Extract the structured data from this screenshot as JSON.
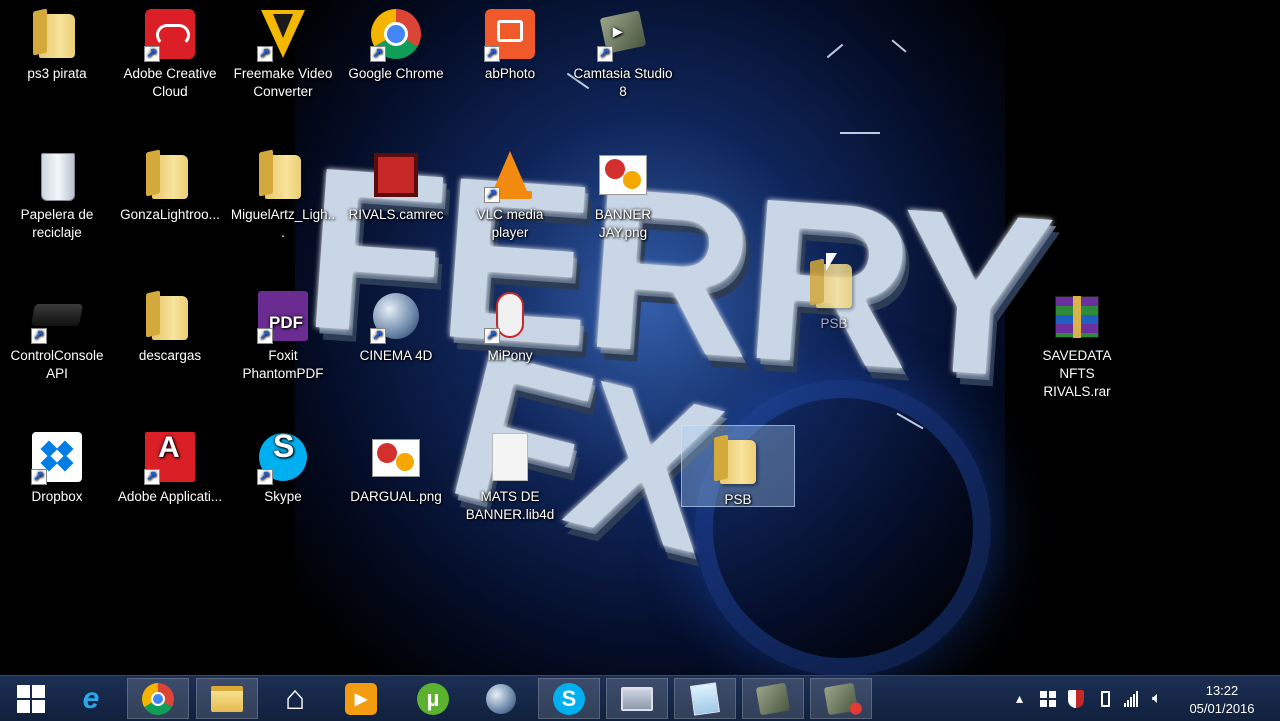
{
  "desktop": {
    "wallpaper": {
      "words": [
        "FERRY",
        "FX"
      ]
    },
    "icons": [
      {
        "label": "ps3 pirata",
        "icon": "folder-icon"
      },
      {
        "label": "Adobe Creative Cloud",
        "icon": "adobe-creative-cloud-icon"
      },
      {
        "label": "Freemake Video Converter",
        "icon": "freemake-icon"
      },
      {
        "label": "Google Chrome",
        "icon": "chrome-icon"
      },
      {
        "label": "abPhoto",
        "icon": "abphoto-icon"
      },
      {
        "label": "Camtasia Studio 8",
        "icon": "camtasia-icon"
      },
      {
        "label": "Papelera de reciclaje",
        "icon": "recycle-bin-icon"
      },
      {
        "label": "GonzaLightroo...",
        "icon": "folder-icon"
      },
      {
        "label": "MiguelArtz_Ligh...",
        "icon": "folder-icon"
      },
      {
        "label": "RIVALS.camrec",
        "icon": "camrec-file-icon"
      },
      {
        "label": "VLC media player",
        "icon": "vlc-icon"
      },
      {
        "label": "BANNER JAY.png",
        "icon": "png-image-icon"
      },
      {
        "label": "ControlConsole API",
        "icon": "console-icon"
      },
      {
        "label": "descargas",
        "icon": "folder-icon"
      },
      {
        "label": "Foxit PhantomPDF",
        "icon": "foxit-pdf-icon"
      },
      {
        "label": "CINEMA 4D",
        "icon": "cinema4d-icon"
      },
      {
        "label": "MiPony",
        "icon": "mipony-icon"
      },
      {
        "label": "PSB",
        "icon": "folder-icon"
      },
      {
        "label": "SAVEDATA NFTS RIVALS.rar",
        "icon": "winrar-icon"
      },
      {
        "label": "Dropbox",
        "icon": "dropbox-icon"
      },
      {
        "label": "Adobe Applicati...",
        "icon": "adobe-app-manager-icon"
      },
      {
        "label": "Skype",
        "icon": "skype-icon"
      },
      {
        "label": "DARGUAL.png",
        "icon": "png-image-icon"
      },
      {
        "label": "MATS DE BANNER.lib4d",
        "icon": "blank-file-icon"
      },
      {
        "label": "PSB",
        "icon": "folder-icon"
      }
    ]
  },
  "taskbar": {
    "start": {
      "icon": "windows-start-icon"
    },
    "apps": [
      {
        "icon": "internet-explorer-icon",
        "glyph": "e"
      },
      {
        "icon": "chrome-icon",
        "glyph": ""
      },
      {
        "icon": "file-explorer-icon",
        "glyph": ""
      },
      {
        "icon": "home-icon",
        "glyph": "⌂"
      },
      {
        "icon": "media-player-icon",
        "glyph": "▶"
      },
      {
        "icon": "utorrent-icon",
        "glyph": "µ"
      },
      {
        "icon": "cinema4d-icon",
        "glyph": ""
      },
      {
        "icon": "skype-icon",
        "glyph": "S"
      },
      {
        "icon": "monitor-icon",
        "glyph": ""
      },
      {
        "icon": "notepad-icon",
        "glyph": ""
      },
      {
        "icon": "camtasia-icon",
        "glyph": ""
      },
      {
        "icon": "camtasia-recorder-icon",
        "glyph": ""
      }
    ],
    "tray": {
      "icons": [
        "show-hidden-icons-icon",
        "action-center-icon",
        "security-shield-icon",
        "battery-icon",
        "signal-icon",
        "volume-icon"
      ]
    },
    "clock": {
      "time": "13:22",
      "date": "05/01/2016"
    }
  },
  "colors": {
    "taskbar": "#10203d",
    "chrome_red": "#db4437",
    "chrome_green": "#0f9d58",
    "chrome_yellow": "#f4b400",
    "chrome_blue": "#4285f4",
    "adobe_red": "#da1f26",
    "skype_blue": "#00aff0",
    "foxit_purple": "#6b2c91",
    "dropbox_blue": "#007ee5"
  }
}
